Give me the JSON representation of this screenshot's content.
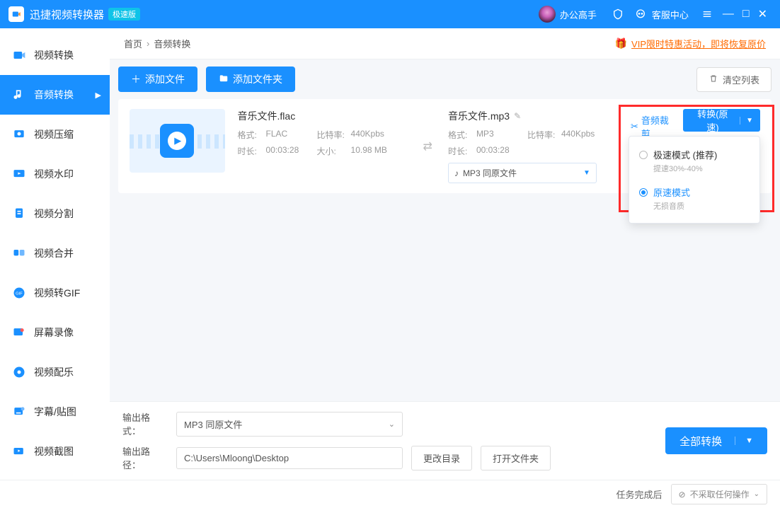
{
  "titlebar": {
    "app_name": "迅捷视频转换器",
    "badge": "极速版",
    "user": "办公高手",
    "help": "客服中心"
  },
  "sidebar": {
    "items": [
      {
        "label": "视频转换"
      },
      {
        "label": "音频转换"
      },
      {
        "label": "视频压缩"
      },
      {
        "label": "视频水印"
      },
      {
        "label": "视频分割"
      },
      {
        "label": "视频合并"
      },
      {
        "label": "视频转GIF"
      },
      {
        "label": "屏幕录像"
      },
      {
        "label": "视频配乐"
      },
      {
        "label": "字幕/贴图"
      },
      {
        "label": "视频截图"
      }
    ],
    "active_index": 1
  },
  "crumbs": {
    "home": "首页",
    "current": "音频转换"
  },
  "promo": "VIP限时特惠活动，即将恢复原价",
  "toolbar": {
    "add_file": "添加文件",
    "add_folder": "添加文件夹",
    "clear": "清空列表"
  },
  "item": {
    "src_name": "音乐文件.flac",
    "l_format": "格式:",
    "src_format": "FLAC",
    "l_bitrate": "比特率:",
    "src_bitrate": "440Kpbs",
    "l_duration": "时长:",
    "src_dur": "00:03:28",
    "l_size": "大小:",
    "src_size": "10.98 MB",
    "dst_name": "音乐文件.mp3",
    "dst_format": "MP3",
    "dst_bitrate": "440Kpbs",
    "dst_dur": "00:03:28",
    "dst_select": "MP3  同原文件",
    "crop": "音频裁剪",
    "convert_btn": "转换(原速)"
  },
  "modes": {
    "fast_title": "极速模式 (推荐)",
    "fast_sub": "提速30%-40%",
    "orig_title": "原速模式",
    "orig_sub": "无损音质",
    "selected": "orig"
  },
  "footer": {
    "fmt_label": "输出格式：",
    "fmt_value": "MP3  同原文件",
    "path_label": "输出路径：",
    "path_value": "C:\\Users\\Mloong\\Desktop",
    "change_dir": "更改目录",
    "open_dir": "打开文件夹",
    "convert_all": "全部转换"
  },
  "status": {
    "after_label": "任务完成后",
    "after_value": "不采取任何操作"
  }
}
